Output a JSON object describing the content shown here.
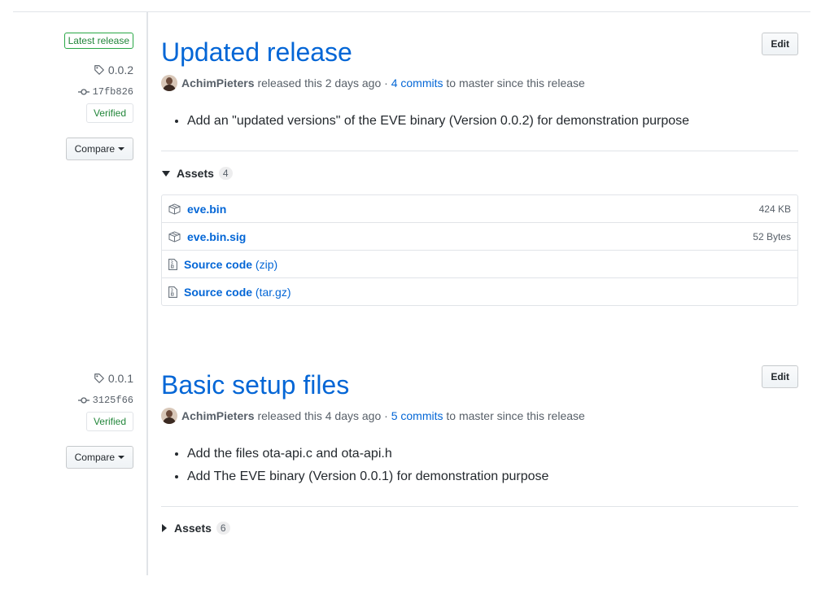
{
  "releases": [
    {
      "latest_badge": "Latest release",
      "tag": "0.0.2",
      "commit": "17fb826",
      "verified": "Verified",
      "compare": "Compare",
      "title": "Updated release",
      "edit": "Edit",
      "author": "AchimPieters",
      "released_text": "released this 2 days ago ·",
      "commits_link": "4 commits",
      "commits_suffix": "to master since this release",
      "notes": [
        "Add an \"updated versions\" of the EVE binary (Version 0.0.2) for demonstration purpose"
      ],
      "assets_label": "Assets",
      "assets_count": "4",
      "assets": [
        {
          "name": "eve.bin",
          "ext": "",
          "size": "424 KB",
          "icon": "package-icon"
        },
        {
          "name": "eve.bin.sig",
          "ext": "",
          "size": "52 Bytes",
          "icon": "package-icon"
        },
        {
          "name": "Source code",
          "ext": "(zip)",
          "size": "",
          "icon": "file-zip-icon"
        },
        {
          "name": "Source code",
          "ext": "(tar.gz)",
          "size": "",
          "icon": "file-zip-icon"
        }
      ]
    },
    {
      "tag": "0.0.1",
      "commit": "3125f66",
      "verified": "Verified",
      "compare": "Compare",
      "title": "Basic setup files",
      "edit": "Edit",
      "author": "AchimPieters",
      "released_text": "released this 4 days ago ·",
      "commits_link": "5 commits",
      "commits_suffix": "to master since this release",
      "notes": [
        "Add the files ota-api.c and ota-api.h",
        "Add The EVE binary (Version 0.0.1) for demonstration purpose"
      ],
      "assets_label": "Assets",
      "assets_count": "6"
    }
  ]
}
